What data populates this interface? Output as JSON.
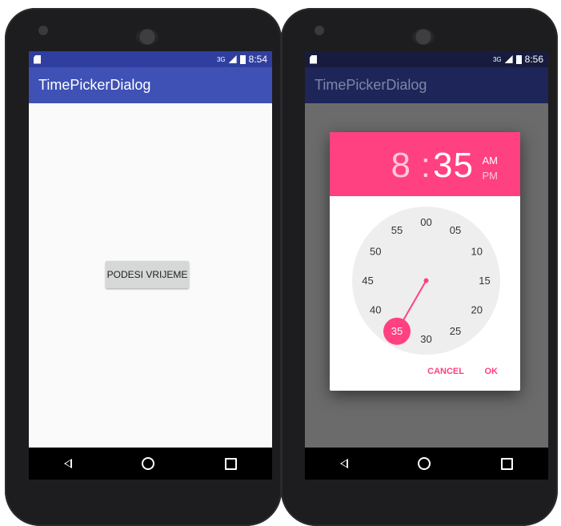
{
  "left_phone": {
    "status_bar": {
      "network": "3G",
      "time": "8:54"
    },
    "app_title": "TimePickerDialog",
    "button_label": "PODESI VRIJEME"
  },
  "right_phone": {
    "status_bar": {
      "network": "3G",
      "time": "8:56"
    },
    "app_title": "TimePickerDialog",
    "dialog": {
      "hour": "8",
      "separator": ":",
      "minute": "35",
      "am": "AM",
      "pm": "PM",
      "selected_period": "AM",
      "selected_minute": "35",
      "clock_labels": [
        "00",
        "05",
        "10",
        "15",
        "20",
        "25",
        "30",
        "35",
        "40",
        "45",
        "50",
        "55"
      ],
      "cancel_label": "CANCEL",
      "ok_label": "OK"
    }
  },
  "colors": {
    "primary": "#3f51b5",
    "primary_dark": "#303f9f",
    "accent": "#ff4081",
    "clock_face": "#eeeeee"
  },
  "icons": [
    "sd-card-icon",
    "signal-icon",
    "battery-icon",
    "nav-back-icon",
    "nav-home-icon",
    "nav-recents-icon"
  ]
}
